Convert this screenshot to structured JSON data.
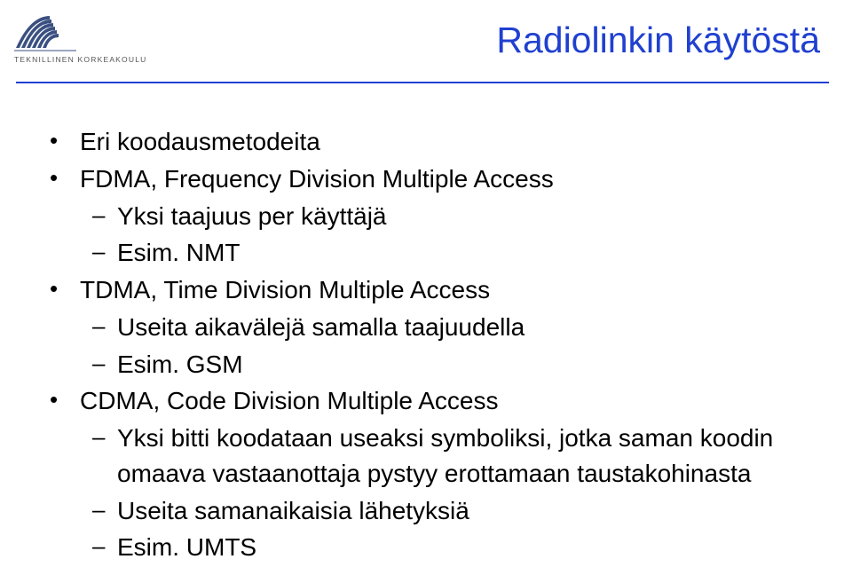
{
  "logo": {
    "org_name": "TEKNILLINEN KORKEAKOULU"
  },
  "title": "Radiolinkin käytöstä",
  "bullets": {
    "b1": "Eri koodausmetodeita",
    "b2": "FDMA, Frequency Division Multiple Access",
    "b2_1": "Yksi taajuus per käyttäjä",
    "b2_2": "Esim. NMT",
    "b3": "TDMA, Time Division Multiple Access",
    "b3_1": "Useita aikavälejä samalla taajuudella",
    "b3_2": "Esim. GSM",
    "b4": "CDMA, Code Division Multiple Access",
    "b4_1": "Yksi bitti koodataan useaksi symboliksi, jotka saman koodin omaava vastaanottaja pystyy erottamaan taustakohinasta",
    "b4_2": "Useita samanaikaisia lähetyksiä",
    "b4_3": "Esim. UMTS"
  }
}
